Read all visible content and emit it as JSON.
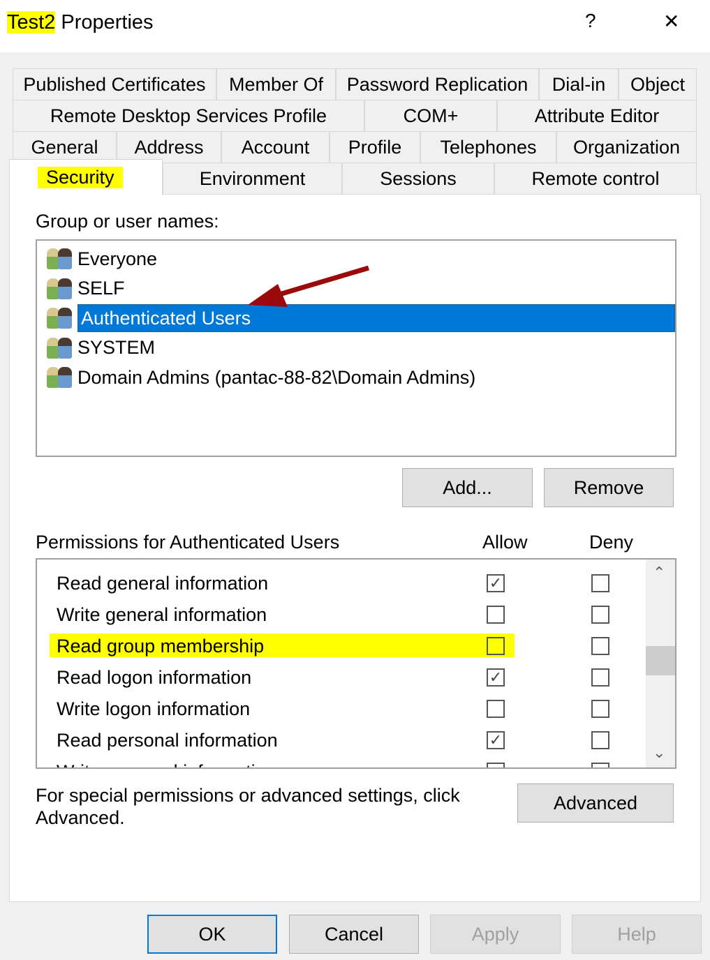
{
  "window": {
    "title_highlight": "Test2",
    "title_rest": " Properties",
    "help": "?",
    "close": "✕"
  },
  "tabs": {
    "row1": [
      "Published Certificates",
      "Member Of",
      "Password Replication",
      "Dial-in",
      "Object"
    ],
    "row2": [
      "Remote Desktop Services Profile",
      "COM+",
      "Attribute Editor"
    ],
    "row3": [
      "General",
      "Address",
      "Account",
      "Profile",
      "Telephones",
      "Organization"
    ],
    "row4": [
      "Security",
      "Environment",
      "Sessions",
      "Remote control"
    ]
  },
  "security": {
    "group_label": "Group or user names:",
    "users": [
      "Everyone",
      "SELF",
      "Authenticated Users",
      "SYSTEM",
      "Domain Admins (pantac-88-82\\Domain Admins)"
    ],
    "selected_user": "Authenticated Users",
    "add": "Add...",
    "remove": "Remove",
    "perm_label": "Permissions for Authenticated Users",
    "allow": "Allow",
    "deny": "Deny",
    "permissions": [
      {
        "name": "Read general information",
        "allow": true,
        "deny": false
      },
      {
        "name": "Write general information",
        "allow": false,
        "deny": false
      },
      {
        "name": "Read group membership",
        "allow": false,
        "deny": false
      },
      {
        "name": "Read logon information",
        "allow": true,
        "deny": false
      },
      {
        "name": "Write logon information",
        "allow": false,
        "deny": false
      },
      {
        "name": "Read personal information",
        "allow": true,
        "deny": false
      },
      {
        "name": "Write personal information",
        "allow": false,
        "deny": false
      }
    ],
    "advanced_text": "For special permissions or advanced settings, click Advanced.",
    "advanced": "Advanced"
  },
  "buttons": {
    "ok": "OK",
    "cancel": "Cancel",
    "apply": "Apply",
    "help": "Help"
  },
  "colors": {
    "selection": "#0078d7",
    "highlight": "#ffff00",
    "arrow": "#9b0a0a"
  }
}
